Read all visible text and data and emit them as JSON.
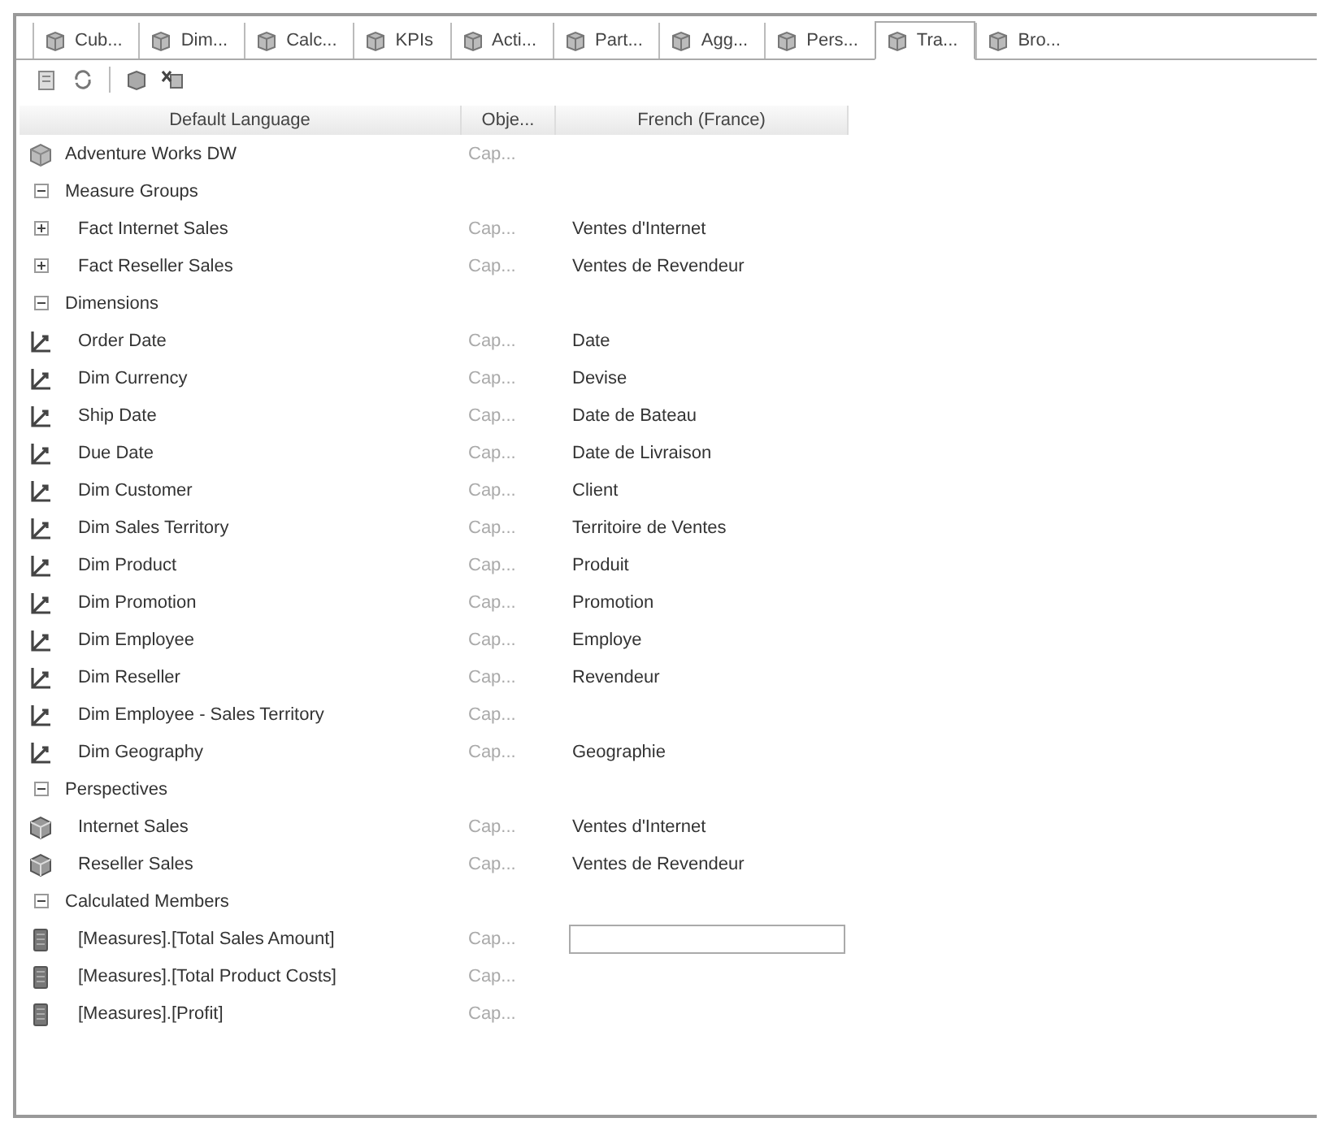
{
  "tabs": [
    {
      "label": "Cub...",
      "selected": false
    },
    {
      "label": "Dim...",
      "selected": false
    },
    {
      "label": "Calc...",
      "selected": false
    },
    {
      "label": "KPIs",
      "selected": false
    },
    {
      "label": "Acti...",
      "selected": false
    },
    {
      "label": "Part...",
      "selected": false
    },
    {
      "label": "Agg...",
      "selected": false
    },
    {
      "label": "Pers...",
      "selected": false
    },
    {
      "label": "Tra...",
      "selected": true
    },
    {
      "label": "Bro...",
      "selected": false
    }
  ],
  "grid": {
    "columns": [
      "Default Language",
      "Obje...",
      "French (France)"
    ],
    "rows": [
      {
        "kind": "cube",
        "name": "Adventure Works DW",
        "object": "Cap..."
      },
      {
        "kind": "group",
        "name": "Measure Groups",
        "expanded": true,
        "children": [
          {
            "kind": "measure_group",
            "name": "Fact Internet Sales",
            "object": "Cap...",
            "translation": "Ventes d'Internet",
            "expanded": false
          },
          {
            "kind": "measure_group",
            "name": "Fact Reseller Sales",
            "object": "Cap...",
            "translation": "Ventes de Revendeur",
            "expanded": false
          }
        ]
      },
      {
        "kind": "group",
        "name": "Dimensions",
        "expanded": true,
        "children": [
          {
            "kind": "dimension",
            "name": "Order Date",
            "object": "Cap...",
            "translation": "Date"
          },
          {
            "kind": "dimension",
            "name": "Dim Currency",
            "object": "Cap...",
            "translation": "Devise"
          },
          {
            "kind": "dimension",
            "name": "Ship Date",
            "object": "Cap...",
            "translation": "Date de Bateau"
          },
          {
            "kind": "dimension",
            "name": "Due Date",
            "object": "Cap...",
            "translation": "Date de Livraison"
          },
          {
            "kind": "dimension",
            "name": "Dim Customer",
            "object": "Cap...",
            "translation": "Client"
          },
          {
            "kind": "dimension",
            "name": "Dim Sales Territory",
            "object": "Cap...",
            "translation": "Territoire de Ventes"
          },
          {
            "kind": "dimension",
            "name": "Dim Product",
            "object": "Cap...",
            "translation": "Produit"
          },
          {
            "kind": "dimension",
            "name": "Dim Promotion",
            "object": "Cap...",
            "translation": "Promotion"
          },
          {
            "kind": "dimension",
            "name": "Dim Employee",
            "object": "Cap...",
            "translation": "Employe"
          },
          {
            "kind": "dimension",
            "name": "Dim Reseller",
            "object": "Cap...",
            "translation": "Revendeur"
          },
          {
            "kind": "dimension",
            "name": "Dim Employee - Sales Territory",
            "object": "Cap..."
          },
          {
            "kind": "dimension",
            "name": "Dim Geography",
            "object": "Cap...",
            "translation": "Geographie"
          }
        ]
      },
      {
        "kind": "group",
        "name": "Perspectives",
        "expanded": true,
        "children": [
          {
            "kind": "perspective",
            "name": "Internet Sales",
            "object": "Cap...",
            "translation": "Ventes d'Internet"
          },
          {
            "kind": "perspective",
            "name": "Reseller Sales",
            "object": "Cap...",
            "translation": "Ventes de Revendeur"
          }
        ]
      },
      {
        "kind": "group",
        "name": "Calculated Members",
        "expanded": true,
        "children": [
          {
            "kind": "measure",
            "name": "[Measures].[Total Sales Amount]",
            "object": "Cap...",
            "editing": true
          },
          {
            "kind": "measure",
            "name": "[Measures].[Total Product Costs]",
            "object": "Cap..."
          },
          {
            "kind": "measure",
            "name": "[Measures].[Profit]",
            "object": "Cap..."
          }
        ]
      }
    ]
  }
}
